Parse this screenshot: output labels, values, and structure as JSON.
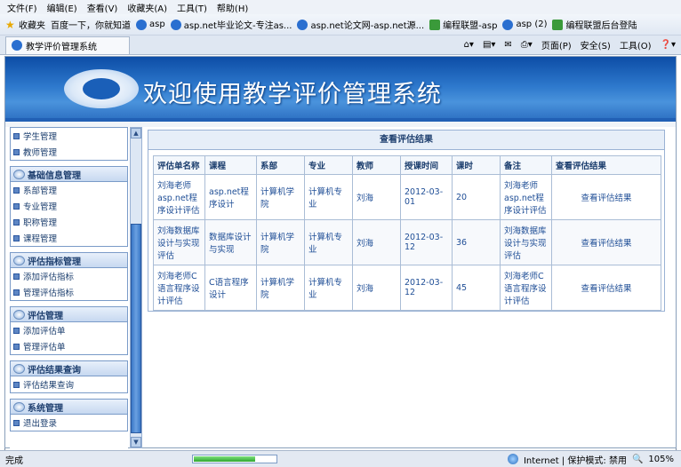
{
  "menu": [
    "文件(F)",
    "编辑(E)",
    "查看(V)",
    "收藏夹(A)",
    "工具(T)",
    "帮助(H)"
  ],
  "favorites": {
    "label": "收藏夹",
    "links": [
      "百度一下，你就知道",
      "asp",
      "asp.net毕业论文-专注as...",
      "asp.net论文网-asp.net源...",
      "编程联盟-asp",
      "asp (2)",
      "编程联盟后台登陆"
    ]
  },
  "tab": {
    "title": "教学评价管理系统"
  },
  "toolbar": {
    "page": "页面(P)",
    "safety": "安全(S)",
    "tools": "工具(O)"
  },
  "banner": {
    "title": "欢迎使用教学评价管理系统"
  },
  "sidebar": {
    "groups": [
      {
        "title": "",
        "items": [
          "学生管理",
          "教师管理"
        ]
      },
      {
        "title": "基础信息管理",
        "items": [
          "系部管理",
          "专业管理",
          "职称管理",
          "课程管理"
        ]
      },
      {
        "title": "评估指标管理",
        "items": [
          "添加评估指标",
          "管理评估指标"
        ]
      },
      {
        "title": "评估管理",
        "items": [
          "添加评估单",
          "管理评估单"
        ]
      },
      {
        "title": "评估结果查询",
        "items": [
          "评估结果查询"
        ]
      },
      {
        "title": "系统管理",
        "items": [
          "退出登录"
        ]
      }
    ]
  },
  "results": {
    "title": "查看评估结果",
    "columns": [
      "评估单名称",
      "课程",
      "系部",
      "专业",
      "教师",
      "授课时间",
      "课时",
      "备注",
      "查看评估结果"
    ],
    "rows": [
      [
        "刘海老师asp.net程序设计评估",
        "asp.net程序设计",
        "计算机学院",
        "计算机专业",
        "刘海",
        "2012-03-01",
        "20",
        "刘海老师asp.net程序设计评估",
        "查看评估结果"
      ],
      [
        "刘海数据库设计与实现评估",
        "数据库设计与实现",
        "计算机学院",
        "计算机专业",
        "刘海",
        "2012-03-12",
        "36",
        "刘海数据库设计与实现评估",
        "查看评估结果"
      ],
      [
        "刘海老师C语言程序设计评估",
        "C语言程序设计",
        "计算机学院",
        "计算机专业",
        "刘海",
        "2012-03-12",
        "45",
        "刘海老师C语言程序设计评估",
        "查看评估结果"
      ]
    ]
  },
  "status": {
    "left": "完成",
    "progress": 0.75,
    "zone": "Internet | 保护模式: 禁用",
    "zoom": "105%"
  }
}
